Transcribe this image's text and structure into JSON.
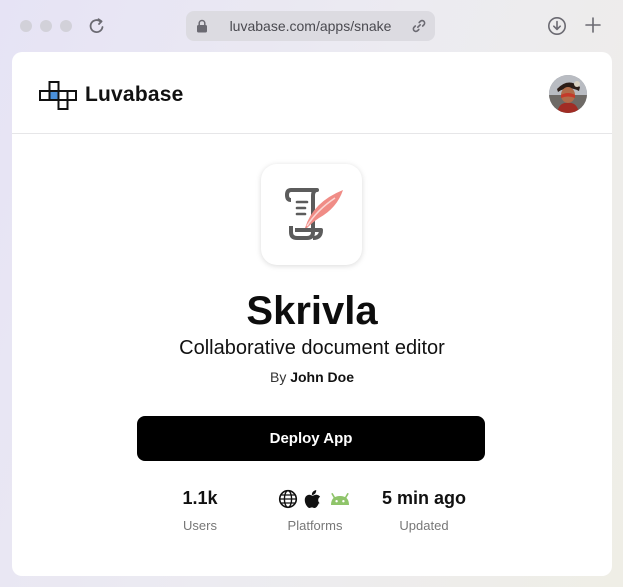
{
  "browser": {
    "url": "luvabase.com/apps/snake"
  },
  "header": {
    "brand": "Luvabase"
  },
  "app": {
    "name": "Skrivla",
    "tagline": "Collaborative document editor",
    "by_label": "By",
    "author": "John Doe",
    "deploy_label": "Deploy App"
  },
  "stats": {
    "users_value": "1.1k",
    "users_label": "Users",
    "platforms_label": "Platforms",
    "platforms": [
      "globe-icon",
      "apple-icon",
      "android-icon"
    ],
    "updated_value": "5 min ago",
    "updated_label": "Updated"
  },
  "colors": {
    "accent_button": "#000000",
    "android_green": "#8fc46a",
    "quill_pink": "#f08c86",
    "logo_blue": "#4a8fd8"
  }
}
